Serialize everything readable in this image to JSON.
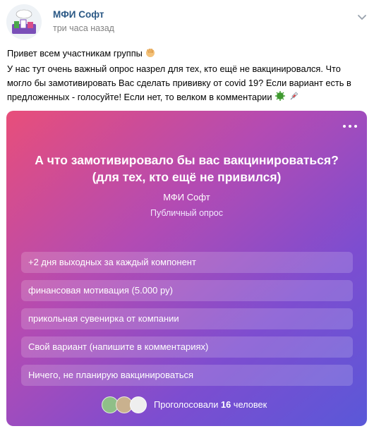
{
  "post": {
    "author": "МФИ Софт",
    "time": "три часа назад",
    "text_lines": [
      "Привет всем участникам группы",
      "У нас тут очень важный опрос назрел для тех, кто ещё не вакцинировался. Что",
      "могло бы замотивировать Вас сделать прививку от covid 19? Если вариант есть в",
      "предложенных - голосуйте! Если нет, то велком в комментарии"
    ],
    "emoji": {
      "wave": "waving-hand-icon",
      "virus": "microbe-icon",
      "syringe": "syringe-icon"
    }
  },
  "poll": {
    "question_line1": "А что замотивировало бы вас вакцинироваться?",
    "question_line2": "(для тех, кто ещё не привился)",
    "author": "МФИ Софт",
    "type": "Публичный опрос",
    "options": [
      "+2 дня выходных за каждый компонент",
      "финансовая мотивация (5.000 ру)",
      "прикольная сувенирка от компании",
      "Свой вариант (напишите в комментариях)",
      "Ничего, не планирую вакцинироваться"
    ],
    "voted_prefix": "Проголосовали",
    "voted_count": "16",
    "voted_suffix": "человек"
  },
  "colors": {
    "author_link": "#2a5885",
    "gradient_start": "#e84e7a",
    "gradient_end": "#5a58d8"
  }
}
